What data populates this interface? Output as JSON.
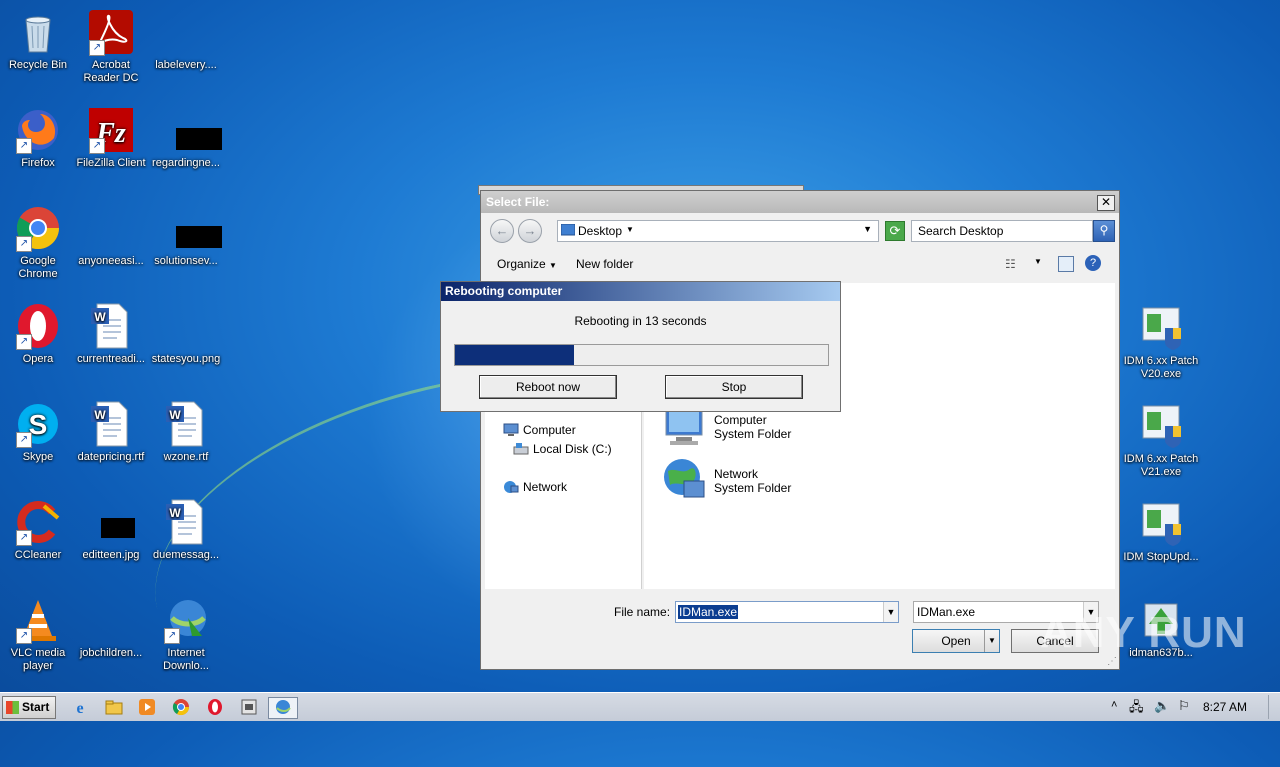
{
  "desktop": {
    "icons": [
      {
        "label": "Recycle Bin"
      },
      {
        "label": "Acrobat Reader DC"
      },
      {
        "label": "labelevery...."
      },
      {
        "label": "Firefox"
      },
      {
        "label": "FileZilla Client"
      },
      {
        "label": "regardingne..."
      },
      {
        "label": "Google Chrome"
      },
      {
        "label": "anyoneeasi..."
      },
      {
        "label": "solutionsev..."
      },
      {
        "label": "Opera"
      },
      {
        "label": "currentreadi..."
      },
      {
        "label": "statesyou.png"
      },
      {
        "label": "Skype"
      },
      {
        "label": "datepricing.rtf"
      },
      {
        "label": "wzone.rtf"
      },
      {
        "label": "CCleaner"
      },
      {
        "label": "editteen.jpg"
      },
      {
        "label": "duemessag..."
      },
      {
        "label": "VLC media player"
      },
      {
        "label": "jobchildren..."
      },
      {
        "label": "Internet Downlo..."
      },
      {
        "label": "IDM 6.xx Patch V20.exe"
      },
      {
        "label": "IDM 6.xx Patch V21.exe"
      },
      {
        "label": "IDM StopUpd..."
      },
      {
        "label": "idman637b..."
      }
    ]
  },
  "file_dialog": {
    "title": "Select File:",
    "close": "✕",
    "address": "Desktop",
    "search_placeholder": "Search Desktop",
    "toolbar": {
      "organize": "Organize",
      "new_folder": "New folder"
    },
    "tree": [
      {
        "label": "Computer"
      },
      {
        "label": "Local Disk (C:)"
      },
      {
        "label": "Network"
      }
    ],
    "items": [
      {
        "name": "Computer",
        "type": "System Folder"
      },
      {
        "name": "Network",
        "type": "System Folder"
      }
    ],
    "file_name_label": "File name:",
    "file_name_value": "IDMan.exe",
    "file_type_value": "IDMan.exe",
    "open_label": "Open",
    "cancel_label": "Cancel"
  },
  "reboot_dialog": {
    "title": "Rebooting computer",
    "message": "Rebooting in 13 seconds",
    "progress": 0.32,
    "reboot_now_label": "Reboot now",
    "stop_label": "Stop"
  },
  "taskbar": {
    "start_label": "Start",
    "clock": "8:27 AM"
  },
  "watermark": "ANY RUN"
}
